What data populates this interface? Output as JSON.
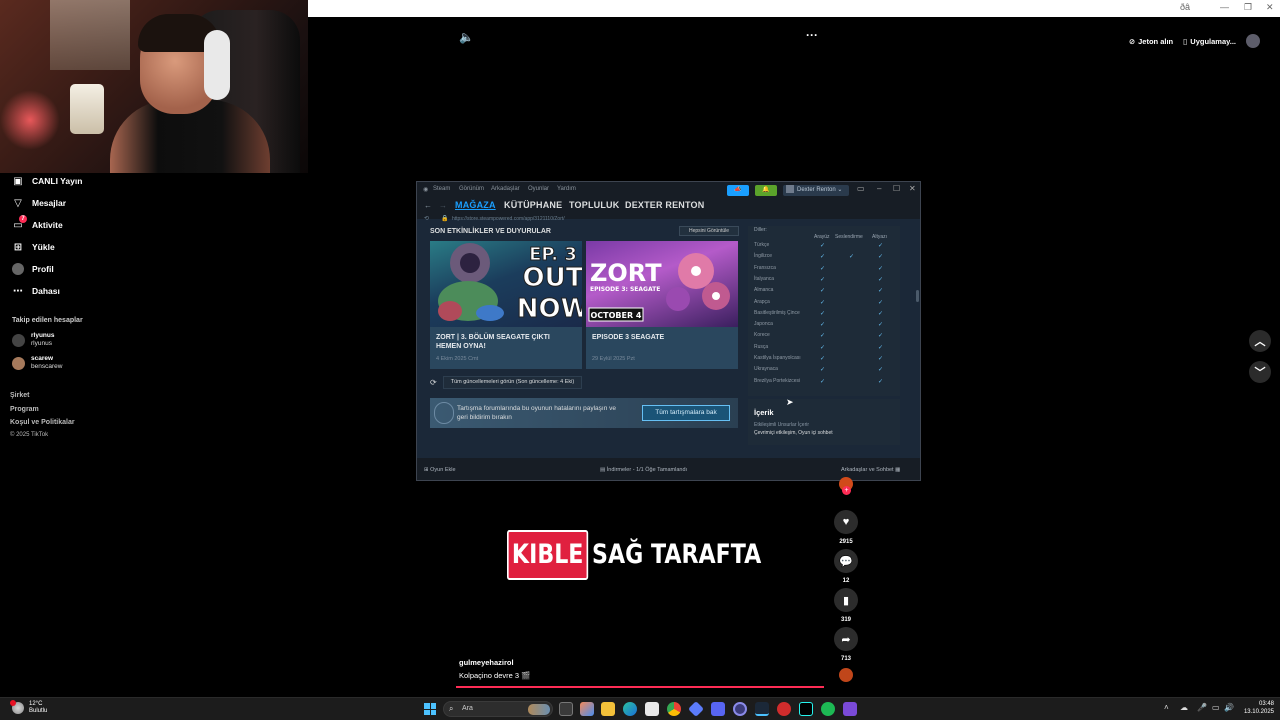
{
  "browser": {
    "top_strip_text": "ðâ"
  },
  "tiktok": {
    "sidebar": [
      {
        "label": "CANLI Yayın",
        "icon": "live-icon"
      },
      {
        "label": "Mesajlar",
        "icon": "inbox-icon"
      },
      {
        "label": "Aktivite",
        "icon": "activity-icon",
        "badge": "7"
      },
      {
        "label": "Yükle",
        "icon": "upload-icon"
      },
      {
        "label": "Profil",
        "icon": "profile-icon"
      },
      {
        "label": "Dahası",
        "icon": "more-icon"
      }
    ],
    "following_header": "Takip edilen hesaplar",
    "following": [
      {
        "name": "rlyunus",
        "handle": "rlyunus"
      },
      {
        "name": "scarew",
        "handle": "benscarew"
      }
    ],
    "footer": [
      "Şirket",
      "Program",
      "Koşul ve Politikalar",
      "© 2025 TikTok"
    ],
    "top_right": {
      "coins": "Jeton alın",
      "app": "Uygulamay..."
    },
    "caption": {
      "highlight": "KIBLE",
      "rest": "SAĞ TARAFTA"
    },
    "actions": {
      "likes": "2915",
      "comments": "12",
      "saves": "319",
      "shares": "713"
    },
    "video_author": "gulmeyehazirol",
    "video_desc": "Kolpaçino devre 3 🎬"
  },
  "steam": {
    "title_menu": [
      "Steam",
      "Görünüm",
      "Arkadaşlar",
      "Oyunlar",
      "Yardım"
    ],
    "user": "Dexter Renton",
    "nav": [
      "MAĞAZA",
      "KÜTÜPHANE",
      "TOPLULUK",
      "DEXTER RENTON"
    ],
    "url": "https://store.steampowered.com/app/3121110/Zort/",
    "section_title": "SON ETKİNLİKLER VE DUYURULAR",
    "view_all": "Hepsini Görüntüle",
    "cards": [
      {
        "art_line1": "EP. 3",
        "art_line2": "OUT",
        "art_line3": "NOW",
        "title": "ZORT | 3. BÖLÜM SEAGATE ÇIKTI HEMEN OYNA!",
        "date": "4 Ekim 2025 Cmt"
      },
      {
        "art_line1": "ZORT",
        "art_line2": "EPISODE 3: SEAGATE",
        "art_line3": "OCTOBER 4",
        "title": "EPISODE 3 SEAGATE",
        "date": "29 Eylül 2025 Pzt"
      }
    ],
    "updates_button": "Tüm güncellemeleri görün (Son güncelleme: 4 Eki)",
    "discussion_text": "Tartışma forumlarında bu oyunun hatalarını paylaşın ve geri bildirim bırakın",
    "discussion_button": "Tüm tartışmalara bak",
    "languages_label": "Diller:",
    "language_headers": [
      "Arayüz",
      "Seslendirme",
      "Altyazı"
    ],
    "languages": [
      {
        "name": "Türkçe",
        "ui": "✓",
        "audio": "",
        "subs": "✓"
      },
      {
        "name": "İngilizce",
        "ui": "✓",
        "audio": "✓",
        "subs": "✓"
      },
      {
        "name": "Fransızca",
        "ui": "✓",
        "audio": "",
        "subs": "✓"
      },
      {
        "name": "İtalyanca",
        "ui": "✓",
        "audio": "",
        "subs": "✓"
      },
      {
        "name": "Almanca",
        "ui": "✓",
        "audio": "",
        "subs": "✓"
      },
      {
        "name": "Arapça",
        "ui": "✓",
        "audio": "",
        "subs": "✓"
      },
      {
        "name": "Basitleştirilmiş Çince",
        "ui": "✓",
        "audio": "",
        "subs": "✓"
      },
      {
        "name": "Japonca",
        "ui": "✓",
        "audio": "",
        "subs": "✓"
      },
      {
        "name": "Korece",
        "ui": "✓",
        "audio": "",
        "subs": "✓"
      },
      {
        "name": "Rusça",
        "ui": "✓",
        "audio": "",
        "subs": "✓"
      },
      {
        "name": "Kastilya İspanyolcası",
        "ui": "✓",
        "audio": "",
        "subs": "✓"
      },
      {
        "name": "Ukraynaca",
        "ui": "✓",
        "audio": "",
        "subs": "✓"
      },
      {
        "name": "Brezilya Portekizcesi",
        "ui": "✓",
        "audio": "",
        "subs": "✓"
      }
    ],
    "content_title": "İçerik",
    "content_sub": "Etkileşimli Unsurlar İçerir",
    "content_items": "Çevrimiçi etkileşim, Oyun içi sohbet",
    "bottom": {
      "add_game": "Oyun Ekle",
      "downloads": "İndirmeler - 1/1 Öğe Tamamlandı",
      "friends": "Arkadaşlar ve Sohbet"
    }
  },
  "taskbar": {
    "temp": "12°C",
    "weather": "Bulutlu",
    "search_placeholder": "Ara",
    "time": "03:48",
    "date": "13.10.2025"
  }
}
